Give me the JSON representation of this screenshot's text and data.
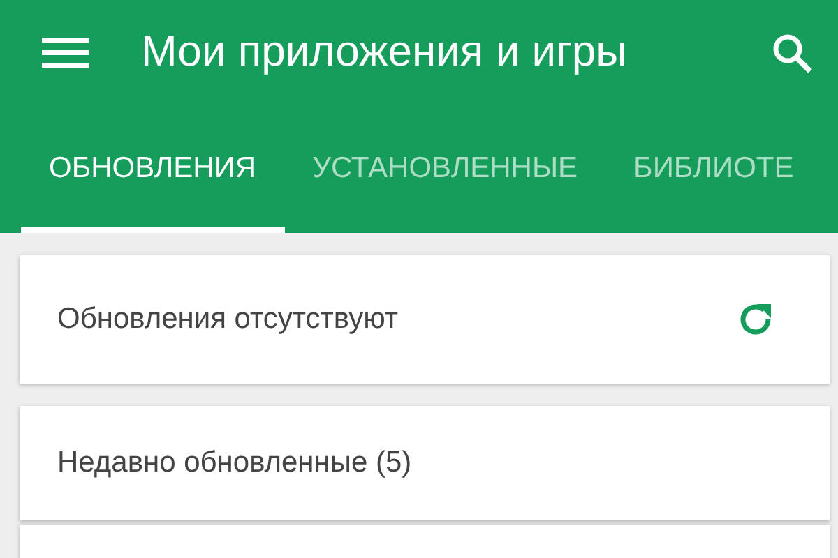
{
  "toolbar": {
    "title": "Мои приложения и игры"
  },
  "tabs": [
    {
      "label": "ОБНОВЛЕНИЯ",
      "selected": true
    },
    {
      "label": "УСТАНОВЛЕННЫЕ",
      "selected": false
    },
    {
      "label": "БИБЛИОТЕ",
      "selected": false
    }
  ],
  "cards": [
    {
      "text": "Обновления отсутствуют",
      "kind": "refresh"
    },
    {
      "text": "Недавно обновленные (5)",
      "kind": "plain"
    }
  ]
}
